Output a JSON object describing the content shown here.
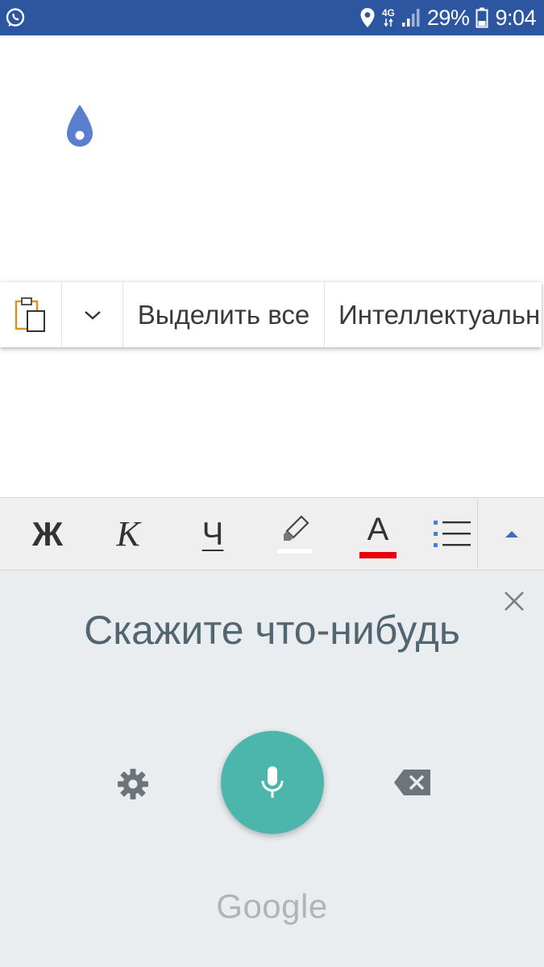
{
  "status_bar": {
    "app_icon": "whatsapp-icon",
    "icons": [
      "location-icon",
      "network-4g-icon",
      "signal-icon",
      "battery-icon"
    ],
    "network_label": "4G",
    "battery": "29%",
    "time": "9:04",
    "background": "#2c56a0"
  },
  "document": {
    "cursor_handle_color": "#5a7fcf"
  },
  "context_menu": {
    "items": [
      {
        "icon": "paste-icon"
      },
      {
        "icon": "chevron-down-icon"
      },
      {
        "label": "Выделить все"
      },
      {
        "label": "Интеллектуальн"
      }
    ]
  },
  "format_toolbar": {
    "bold": "Ж",
    "italic": "К",
    "underline": "Ч",
    "highlight_icon": "highlighter-icon",
    "highlight_color": "#ffffff",
    "font_color_label": "A",
    "font_color": "#e8000b",
    "list_icon": "bullet-list-icon",
    "expand_icon": "caret-up-icon"
  },
  "voice_input": {
    "prompt": "Скажите что-нибудь",
    "close_icon": "close-icon",
    "settings_icon": "gear-icon",
    "mic_icon": "microphone-icon",
    "backspace_icon": "backspace-icon",
    "brand": "Google",
    "mic_color": "#4db6ac"
  }
}
